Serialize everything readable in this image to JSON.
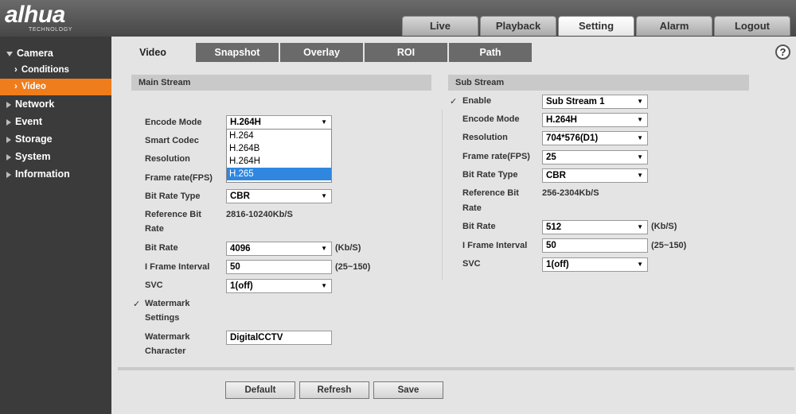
{
  "logo": {
    "word": "alhua",
    "tag": "TECHNOLOGY"
  },
  "topnav": [
    "Live",
    "Playback",
    "Setting",
    "Alarm",
    "Logout"
  ],
  "sidebar": {
    "camera": "Camera",
    "conditions": "Conditions",
    "video": "Video",
    "network": "Network",
    "event": "Event",
    "storage": "Storage",
    "system": "System",
    "information": "Information"
  },
  "tabs": [
    "Video",
    "Snapshot",
    "Overlay",
    "ROI",
    "Path"
  ],
  "main": {
    "title": "Main Stream",
    "encode_mode_label": "Encode Mode",
    "encode_mode": "H.264H",
    "smart_codec_label": "Smart Codec",
    "resolution_label": "Resolution",
    "frame_rate_label": "Frame rate(FPS)",
    "bit_rate_type_label": "Bit Rate Type",
    "bit_rate_type": "CBR",
    "reference_label_1": "Reference Bit",
    "reference_label_2": "Rate",
    "reference_value": "2816-10240Kb/S",
    "bit_rate_label": "Bit Rate",
    "bit_rate": "4096",
    "bit_rate_unit": "(Kb/S)",
    "iframe_label": "I Frame Interval",
    "iframe": "50",
    "iframe_range": "(25~150)",
    "svc_label": "SVC",
    "svc": "1(off)",
    "watermark_label_1": "Watermark",
    "watermark_label_2": "Settings",
    "wm_char_label_1": "Watermark",
    "wm_char_label_2": "Character",
    "wm_char": "DigitalCCTV",
    "dropdown": [
      "H.264",
      "H.264B",
      "H.264H",
      "H.265"
    ]
  },
  "sub": {
    "title": "Sub Stream",
    "enable_label": "Enable",
    "stream": "Sub Stream 1",
    "encode_mode_label": "Encode Mode",
    "encode_mode": "H.264H",
    "resolution_label": "Resolution",
    "resolution": "704*576(D1)",
    "frame_rate_label": "Frame rate(FPS)",
    "frame_rate": "25",
    "bit_rate_type_label": "Bit Rate Type",
    "bit_rate_type": "CBR",
    "reference_label_1": "Reference Bit",
    "reference_label_2": "Rate",
    "reference_value": "256-2304Kb/S",
    "bit_rate_label": "Bit Rate",
    "bit_rate": "512",
    "bit_rate_unit": "(Kb/S)",
    "iframe_label": "I Frame Interval",
    "iframe": "50",
    "iframe_range": "(25~150)",
    "svc_label": "SVC",
    "svc": "1(off)"
  },
  "buttons": {
    "default": "Default",
    "refresh": "Refresh",
    "save": "Save"
  },
  "icons": {
    "check": "✓",
    "arrow": "▼",
    "help": "?"
  },
  "colors": {
    "accent": "#f07d1c",
    "header": "#555555",
    "sidebar": "#3b3b3b",
    "selected": "#2f87e0"
  }
}
